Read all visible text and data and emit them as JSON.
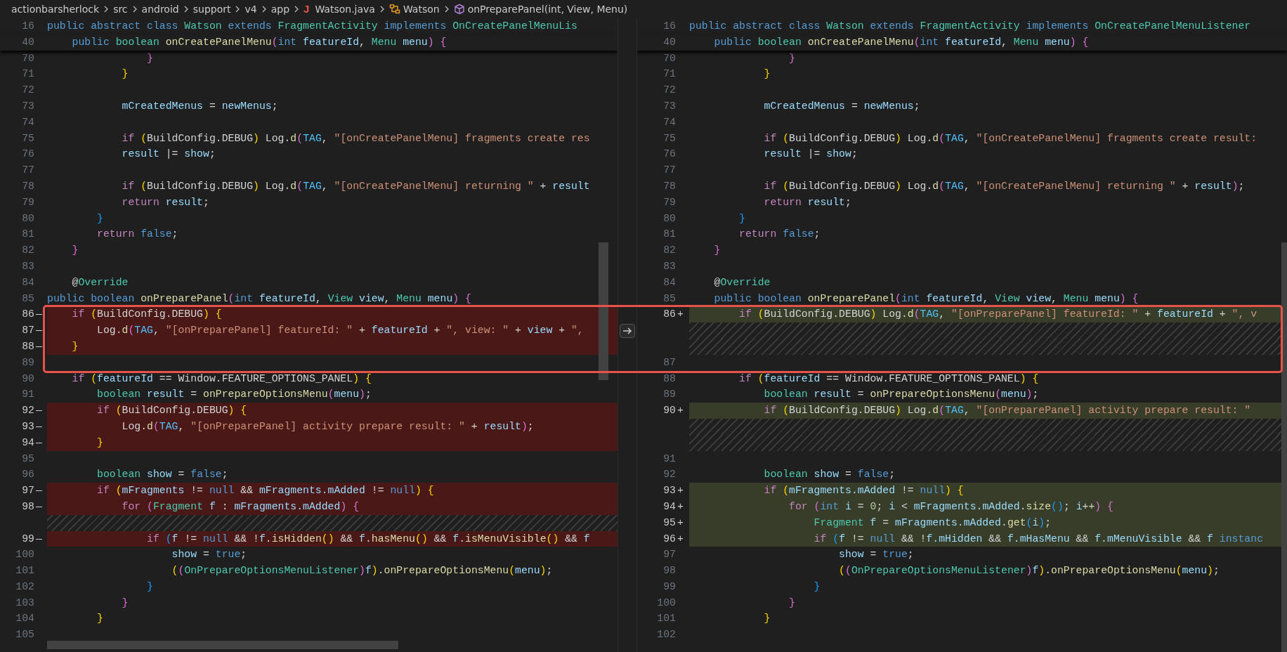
{
  "breadcrumb": [
    {
      "kind": "folder",
      "label": "actionbarsherlock"
    },
    {
      "kind": "folder",
      "label": "src"
    },
    {
      "kind": "folder",
      "label": "android"
    },
    {
      "kind": "folder",
      "label": "support"
    },
    {
      "kind": "folder",
      "label": "v4"
    },
    {
      "kind": "folder",
      "label": "app"
    },
    {
      "kind": "file",
      "glyph": "J",
      "label": "Watson.java"
    },
    {
      "kind": "class",
      "label": "Watson"
    },
    {
      "kind": "method",
      "label": "onPreparePanel(int, View, Menu)"
    }
  ],
  "left_pane": {
    "sticky": [
      {
        "number": "16",
        "tokens": [
          {
            "text": "public",
            "kind": "k"
          },
          {
            "text": " abstract",
            "kind": "k"
          },
          {
            "text": " class",
            "kind": "k"
          },
          {
            "text": " Watson",
            "kind": "t"
          },
          {
            "text": " extends",
            "kind": "k"
          },
          {
            "text": " FragmentActivity",
            "kind": "t"
          },
          {
            "text": " implements",
            "kind": "k"
          },
          {
            "text": " OnCreatePanelMenuLis",
            "kind": "t"
          }
        ]
      },
      {
        "number": "40",
        "tokens": [
          {
            "text": "    public",
            "kind": "k"
          },
          {
            "text": " boolean",
            "kind": "t"
          },
          {
            "text": " onCreatePanelMenu",
            "kind": "f"
          },
          {
            "text": "(",
            "kind": "b2"
          },
          {
            "text": "int",
            "kind": "k"
          },
          {
            "text": " featureId",
            "kind": "v"
          },
          {
            "text": ",",
            "kind": "p"
          },
          {
            "text": " Menu",
            "kind": "t"
          },
          {
            "text": " menu",
            "kind": "v"
          },
          {
            "text": ")",
            "kind": "b2"
          },
          {
            "text": " {",
            "kind": "b2"
          }
        ]
      }
    ],
    "rows": [
      {
        "kind": "context",
        "number": "70",
        "tokens": [
          {
            "text": "                }",
            "kind": "b2"
          }
        ]
      },
      {
        "kind": "context",
        "number": "71",
        "tokens": [
          {
            "text": "            }",
            "kind": "b1"
          }
        ]
      },
      {
        "kind": "context",
        "number": "72"
      },
      {
        "kind": "context",
        "number": "73",
        "tokens": [
          {
            "text": "            mCreatedMenus",
            "kind": "v"
          },
          {
            "text": " =",
            "kind": "p"
          },
          {
            "text": " newMenus",
            "kind": "v"
          },
          {
            "text": ";",
            "kind": "p"
          }
        ]
      },
      {
        "kind": "context",
        "number": "74"
      },
      {
        "kind": "context",
        "number": "75",
        "tokens": [
          {
            "text": "            if",
            "kind": "c"
          },
          {
            "text": " (",
            "kind": "b1"
          },
          {
            "text": "BuildConfig.DEBUG",
            "kind": "p"
          },
          {
            "text": ")",
            "kind": "b1"
          },
          {
            "text": " Log.",
            "kind": "p"
          },
          {
            "text": "d",
            "kind": "f"
          },
          {
            "text": "(",
            "kind": "b2"
          },
          {
            "text": "TAG",
            "kind": "n"
          },
          {
            "text": ",",
            "kind": "p"
          },
          {
            "text": " \"[onCreatePanelMenu] fragments create res",
            "kind": "s"
          }
        ]
      },
      {
        "kind": "context",
        "number": "76",
        "tokens": [
          {
            "text": "            result",
            "kind": "v"
          },
          {
            "text": " |=",
            "kind": "p"
          },
          {
            "text": " show",
            "kind": "v"
          },
          {
            "text": ";",
            "kind": "p"
          }
        ]
      },
      {
        "kind": "context",
        "number": "77"
      },
      {
        "kind": "context",
        "number": "78",
        "tokens": [
          {
            "text": "            if",
            "kind": "c"
          },
          {
            "text": " (",
            "kind": "b1"
          },
          {
            "text": "BuildConfig.DEBUG",
            "kind": "p"
          },
          {
            "text": ")",
            "kind": "b1"
          },
          {
            "text": " Log.",
            "kind": "p"
          },
          {
            "text": "d",
            "kind": "f"
          },
          {
            "text": "(",
            "kind": "b2"
          },
          {
            "text": "TAG",
            "kind": "n"
          },
          {
            "text": ",",
            "kind": "p"
          },
          {
            "text": " \"[onCreatePanelMenu] returning \"",
            "kind": "s"
          },
          {
            "text": " +",
            "kind": "p"
          },
          {
            "text": " result",
            "kind": "v"
          }
        ]
      },
      {
        "kind": "context",
        "number": "79",
        "tokens": [
          {
            "text": "            return",
            "kind": "c"
          },
          {
            "text": " result",
            "kind": "v"
          },
          {
            "text": ";",
            "kind": "p"
          }
        ]
      },
      {
        "kind": "context",
        "number": "80",
        "tokens": [
          {
            "text": "        }",
            "kind": "b3"
          }
        ]
      },
      {
        "kind": "context",
        "number": "81",
        "tokens": [
          {
            "text": "        return",
            "kind": "c"
          },
          {
            "text": " false",
            "kind": "k"
          },
          {
            "text": ";",
            "kind": "p"
          }
        ]
      },
      {
        "kind": "context",
        "number": "82",
        "tokens": [
          {
            "text": "    }",
            "kind": "b2"
          }
        ]
      },
      {
        "kind": "context",
        "number": "83"
      },
      {
        "kind": "context",
        "number": "84",
        "tokens": [
          {
            "text": "    @",
            "kind": "p"
          },
          {
            "text": "Override",
            "kind": "t"
          }
        ]
      },
      {
        "kind": "context",
        "number": "85",
        "tokens": [
          {
            "text": "public",
            "kind": "k"
          },
          {
            "text": " boolean",
            "kind": "k"
          },
          {
            "text": " onPreparePanel",
            "kind": "f"
          },
          {
            "text": "(",
            "kind": "b2"
          },
          {
            "text": "int",
            "kind": "k"
          },
          {
            "text": " featureId",
            "kind": "v"
          },
          {
            "text": ",",
            "kind": "p"
          },
          {
            "text": " View",
            "kind": "t"
          },
          {
            "text": " view",
            "kind": "v"
          },
          {
            "text": ",",
            "kind": "p"
          },
          {
            "text": " Menu",
            "kind": "t"
          },
          {
            "text": " menu",
            "kind": "v"
          },
          {
            "text": ")",
            "kind": "b2"
          },
          {
            "text": " {",
            "kind": "b2"
          }
        ]
      },
      {
        "kind": "removed",
        "number": "86",
        "sign": "—",
        "framed": true,
        "tokens": [
          {
            "text": "    if",
            "kind": "c"
          },
          {
            "text": " (",
            "kind": "b1"
          },
          {
            "text": "BuildConfig.DEBUG",
            "kind": "p"
          },
          {
            "text": ")",
            "kind": "b1"
          },
          {
            "text": " {",
            "kind": "b1"
          }
        ]
      },
      {
        "kind": "removed",
        "number": "87",
        "sign": "—",
        "framed": true,
        "revert_button": true,
        "tokens": [
          {
            "text": "        Log.",
            "kind": "p"
          },
          {
            "text": "d",
            "kind": "f"
          },
          {
            "text": "(",
            "kind": "b2"
          },
          {
            "text": "TAG",
            "kind": "n"
          },
          {
            "text": ",",
            "kind": "p"
          },
          {
            "text": " \"[onPreparePanel] featureId: \"",
            "kind": "s"
          },
          {
            "text": " +",
            "kind": "p"
          },
          {
            "text": " featureId",
            "kind": "v"
          },
          {
            "text": " +",
            "kind": "p"
          },
          {
            "text": " \", view: \"",
            "kind": "s"
          },
          {
            "text": " +",
            "kind": "p"
          },
          {
            "text": " view",
            "kind": "v"
          },
          {
            "text": " +",
            "kind": "p"
          },
          {
            "text": " \",",
            "kind": "s"
          }
        ]
      },
      {
        "kind": "removed",
        "number": "88",
        "sign": "—",
        "framed": true,
        "tokens": [
          {
            "text": "    }",
            "kind": "b1"
          }
        ]
      },
      {
        "kind": "context",
        "number": "89",
        "framed": true
      },
      {
        "kind": "context",
        "number": "90",
        "tokens": [
          {
            "text": "    if",
            "kind": "c"
          },
          {
            "text": " (",
            "kind": "b1"
          },
          {
            "text": "featureId",
            "kind": "v"
          },
          {
            "text": " == Window.FEATURE_OPTIONS_PANEL",
            "kind": "p"
          },
          {
            "text": ")",
            "kind": "b1"
          },
          {
            "text": " {",
            "kind": "b1"
          }
        ]
      },
      {
        "kind": "context",
        "number": "91",
        "tokens": [
          {
            "text": "        boolean",
            "kind": "t"
          },
          {
            "text": " result",
            "kind": "v"
          },
          {
            "text": " =",
            "kind": "p"
          },
          {
            "text": " onPrepareOptionsMenu",
            "kind": "f"
          },
          {
            "text": "(",
            "kind": "b2"
          },
          {
            "text": "menu",
            "kind": "v"
          },
          {
            "text": ")",
            "kind": "b2"
          },
          {
            "text": ";",
            "kind": "p"
          }
        ]
      },
      {
        "kind": "removed",
        "number": "92",
        "sign": "—",
        "tokens": [
          {
            "text": "        if",
            "kind": "c"
          },
          {
            "text": " (",
            "kind": "b1"
          },
          {
            "text": "BuildConfig.DEBUG",
            "kind": "p"
          },
          {
            "text": ")",
            "kind": "b1"
          },
          {
            "text": " {",
            "kind": "b1"
          }
        ]
      },
      {
        "kind": "removed",
        "number": "93",
        "sign": "—",
        "tokens": [
          {
            "text": "            Log.",
            "kind": "p"
          },
          {
            "text": "d",
            "kind": "f"
          },
          {
            "text": "(",
            "kind": "b2"
          },
          {
            "text": "TAG",
            "kind": "n"
          },
          {
            "text": ",",
            "kind": "p"
          },
          {
            "text": " \"[onPreparePanel] activity prepare result: \"",
            "kind": "s"
          },
          {
            "text": " +",
            "kind": "p"
          },
          {
            "text": " result",
            "kind": "v"
          },
          {
            "text": ")",
            "kind": "b2"
          },
          {
            "text": ";",
            "kind": "p"
          }
        ]
      },
      {
        "kind": "removed",
        "number": "94",
        "sign": "—",
        "tokens": [
          {
            "text": "        }",
            "kind": "b1"
          }
        ]
      },
      {
        "kind": "context",
        "number": "95"
      },
      {
        "kind": "context",
        "number": "96",
        "tokens": [
          {
            "text": "        boolean",
            "kind": "t"
          },
          {
            "text": " show",
            "kind": "v"
          },
          {
            "text": " =",
            "kind": "p"
          },
          {
            "text": " false",
            "kind": "k"
          },
          {
            "text": ";",
            "kind": "p"
          }
        ]
      },
      {
        "kind": "removed",
        "number": "97",
        "sign": "—",
        "tokens": [
          {
            "text": "        if",
            "kind": "c"
          },
          {
            "text": " (",
            "kind": "b1"
          },
          {
            "text": "mFragments",
            "kind": "v"
          },
          {
            "text": " !=",
            "kind": "p"
          },
          {
            "text": " null",
            "kind": "k"
          },
          {
            "text": " &&",
            "kind": "p"
          },
          {
            "text": " mFragments.mAdded",
            "kind": "v"
          },
          {
            "text": " !=",
            "kind": "p"
          },
          {
            "text": " null",
            "kind": "k"
          },
          {
            "text": ")",
            "kind": "b1"
          },
          {
            "text": " {",
            "kind": "b1"
          }
        ]
      },
      {
        "kind": "removed",
        "number": "98",
        "sign": "—",
        "tokens": [
          {
            "text": "            for",
            "kind": "c"
          },
          {
            "text": " (",
            "kind": "b2"
          },
          {
            "text": "Fragment",
            "kind": "t"
          },
          {
            "text": " f",
            "kind": "v"
          },
          {
            "text": " :",
            "kind": "p"
          },
          {
            "text": " mFragments.mAdded",
            "kind": "v"
          },
          {
            "text": ")",
            "kind": "b2"
          },
          {
            "text": " {",
            "kind": "b2"
          }
        ]
      },
      {
        "kind": "filler"
      },
      {
        "kind": "removed",
        "number": "99",
        "sign": "—",
        "tokens": [
          {
            "text": "                if",
            "kind": "c"
          },
          {
            "text": " (",
            "kind": "b3"
          },
          {
            "text": "f",
            "kind": "v"
          },
          {
            "text": " !=",
            "kind": "p"
          },
          {
            "text": " null",
            "kind": "k"
          },
          {
            "text": " && !",
            "kind": "p"
          },
          {
            "text": "f",
            "kind": "v"
          },
          {
            "text": ".",
            "kind": "p"
          },
          {
            "text": "isHidden",
            "kind": "f"
          },
          {
            "text": "()",
            "kind": "b1"
          },
          {
            "text": " &&",
            "kind": "p"
          },
          {
            "text": " f",
            "kind": "v"
          },
          {
            "text": ".",
            "kind": "p"
          },
          {
            "text": "hasMenu",
            "kind": "f"
          },
          {
            "text": "()",
            "kind": "b1"
          },
          {
            "text": " &&",
            "kind": "p"
          },
          {
            "text": " f",
            "kind": "v"
          },
          {
            "text": ".",
            "kind": "p"
          },
          {
            "text": "isMenuVisible",
            "kind": "f"
          },
          {
            "text": "()",
            "kind": "b1"
          },
          {
            "text": " &&",
            "kind": "p"
          },
          {
            "text": " f",
            "kind": "v"
          }
        ]
      },
      {
        "kind": "context",
        "number": "100",
        "tokens": [
          {
            "text": "                    show",
            "kind": "v"
          },
          {
            "text": " =",
            "kind": "p"
          },
          {
            "text": " true",
            "kind": "k"
          },
          {
            "text": ";",
            "kind": "p"
          }
        ]
      },
      {
        "kind": "context",
        "number": "101",
        "tokens": [
          {
            "text": "                    (",
            "kind": "b1"
          },
          {
            "text": "(",
            "kind": "b2"
          },
          {
            "text": "OnPrepareOptionsMenuListener",
            "kind": "t"
          },
          {
            "text": ")",
            "kind": "b2"
          },
          {
            "text": "f",
            "kind": "v"
          },
          {
            "text": ")",
            "kind": "b1"
          },
          {
            "text": ".",
            "kind": "p"
          },
          {
            "text": "onPrepareOptionsMenu",
            "kind": "f"
          },
          {
            "text": "(",
            "kind": "b1"
          },
          {
            "text": "menu",
            "kind": "v"
          },
          {
            "text": ")",
            "kind": "b1"
          },
          {
            "text": ";",
            "kind": "p"
          }
        ]
      },
      {
        "kind": "context",
        "number": "102",
        "tokens": [
          {
            "text": "                }",
            "kind": "b3"
          }
        ]
      },
      {
        "kind": "context",
        "number": "103",
        "tokens": [
          {
            "text": "            }",
            "kind": "b2"
          }
        ]
      },
      {
        "kind": "context",
        "number": "104",
        "tokens": [
          {
            "text": "        }",
            "kind": "b1"
          }
        ]
      },
      {
        "kind": "context",
        "number": "105"
      }
    ]
  },
  "right_pane": {
    "sticky": [
      {
        "number": "16",
        "tokens": [
          {
            "text": "public",
            "kind": "k"
          },
          {
            "text": " abstract",
            "kind": "k"
          },
          {
            "text": " class",
            "kind": "k"
          },
          {
            "text": " Watson",
            "kind": "t"
          },
          {
            "text": " extends",
            "kind": "k"
          },
          {
            "text": " FragmentActivity",
            "kind": "t"
          },
          {
            "text": " implements",
            "kind": "k"
          },
          {
            "text": " OnCreatePanelMenuListener",
            "kind": "t"
          }
        ]
      },
      {
        "number": "40",
        "tokens": [
          {
            "text": "    public",
            "kind": "k"
          },
          {
            "text": " boolean",
            "kind": "t"
          },
          {
            "text": " onCreatePanelMenu",
            "kind": "f"
          },
          {
            "text": "(",
            "kind": "b2"
          },
          {
            "text": "int",
            "kind": "k"
          },
          {
            "text": " featureId",
            "kind": "v"
          },
          {
            "text": ",",
            "kind": "p"
          },
          {
            "text": " Menu",
            "kind": "t"
          },
          {
            "text": " menu",
            "kind": "v"
          },
          {
            "text": ")",
            "kind": "b2"
          },
          {
            "text": " {",
            "kind": "b2"
          }
        ]
      }
    ],
    "rows": [
      {
        "kind": "context",
        "number": "70",
        "tokens": [
          {
            "text": "                }",
            "kind": "b2"
          }
        ]
      },
      {
        "kind": "context",
        "number": "71",
        "tokens": [
          {
            "text": "            }",
            "kind": "b1"
          }
        ]
      },
      {
        "kind": "context",
        "number": "72"
      },
      {
        "kind": "context",
        "number": "73",
        "tokens": [
          {
            "text": "            mCreatedMenus",
            "kind": "v"
          },
          {
            "text": " =",
            "kind": "p"
          },
          {
            "text": " newMenus",
            "kind": "v"
          },
          {
            "text": ";",
            "kind": "p"
          }
        ]
      },
      {
        "kind": "context",
        "number": "74"
      },
      {
        "kind": "context",
        "number": "75",
        "tokens": [
          {
            "text": "            if",
            "kind": "c"
          },
          {
            "text": " (",
            "kind": "b1"
          },
          {
            "text": "BuildConfig.DEBUG",
            "kind": "p"
          },
          {
            "text": ")",
            "kind": "b1"
          },
          {
            "text": " Log.",
            "kind": "p"
          },
          {
            "text": "d",
            "kind": "f"
          },
          {
            "text": "(",
            "kind": "b2"
          },
          {
            "text": "TAG",
            "kind": "n"
          },
          {
            "text": ",",
            "kind": "p"
          },
          {
            "text": " \"[onCreatePanelMenu] fragments create result:",
            "kind": "s"
          }
        ]
      },
      {
        "kind": "context",
        "number": "76",
        "tokens": [
          {
            "text": "            result",
            "kind": "v"
          },
          {
            "text": " |=",
            "kind": "p"
          },
          {
            "text": " show",
            "kind": "v"
          },
          {
            "text": ";",
            "kind": "p"
          }
        ]
      },
      {
        "kind": "context",
        "number": "77"
      },
      {
        "kind": "context",
        "number": "78",
        "tokens": [
          {
            "text": "            if",
            "kind": "c"
          },
          {
            "text": " (",
            "kind": "b1"
          },
          {
            "text": "BuildConfig.DEBUG",
            "kind": "p"
          },
          {
            "text": ")",
            "kind": "b1"
          },
          {
            "text": " Log.",
            "kind": "p"
          },
          {
            "text": "d",
            "kind": "f"
          },
          {
            "text": "(",
            "kind": "b2"
          },
          {
            "text": "TAG",
            "kind": "n"
          },
          {
            "text": ",",
            "kind": "p"
          },
          {
            "text": " \"[onCreatePanelMenu] returning \"",
            "kind": "s"
          },
          {
            "text": " +",
            "kind": "p"
          },
          {
            "text": " result",
            "kind": "v"
          },
          {
            "text": ")",
            "kind": "b2"
          },
          {
            "text": ";",
            "kind": "p"
          }
        ]
      },
      {
        "kind": "context",
        "number": "79",
        "tokens": [
          {
            "text": "            return",
            "kind": "c"
          },
          {
            "text": " result",
            "kind": "v"
          },
          {
            "text": ";",
            "kind": "p"
          }
        ]
      },
      {
        "kind": "context",
        "number": "80",
        "tokens": [
          {
            "text": "        }",
            "kind": "b3"
          }
        ]
      },
      {
        "kind": "context",
        "number": "81",
        "tokens": [
          {
            "text": "        return",
            "kind": "c"
          },
          {
            "text": " false",
            "kind": "k"
          },
          {
            "text": ";",
            "kind": "p"
          }
        ]
      },
      {
        "kind": "context",
        "number": "82",
        "tokens": [
          {
            "text": "    }",
            "kind": "b2"
          }
        ]
      },
      {
        "kind": "context",
        "number": "83"
      },
      {
        "kind": "context",
        "number": "84",
        "tokens": [
          {
            "text": "    @",
            "kind": "p"
          },
          {
            "text": "Override",
            "kind": "t"
          }
        ]
      },
      {
        "kind": "context",
        "number": "85",
        "tokens": [
          {
            "text": "    public",
            "kind": "k"
          },
          {
            "text": " boolean",
            "kind": "k"
          },
          {
            "text": " onPreparePanel",
            "kind": "f"
          },
          {
            "text": "(",
            "kind": "b2"
          },
          {
            "text": "int",
            "kind": "k"
          },
          {
            "text": " featureId",
            "kind": "v"
          },
          {
            "text": ",",
            "kind": "p"
          },
          {
            "text": " View",
            "kind": "t"
          },
          {
            "text": " view",
            "kind": "v"
          },
          {
            "text": ",",
            "kind": "p"
          },
          {
            "text": " Menu",
            "kind": "t"
          },
          {
            "text": " menu",
            "kind": "v"
          },
          {
            "text": ")",
            "kind": "b2"
          },
          {
            "text": " {",
            "kind": "b2"
          }
        ]
      },
      {
        "kind": "added",
        "number": "86",
        "sign": "+",
        "tokens": [
          {
            "text": "        if",
            "kind": "c"
          },
          {
            "text": " (",
            "kind": "b1"
          },
          {
            "text": "BuildConfig.DEBUG",
            "kind": "p"
          },
          {
            "text": ")",
            "kind": "b1"
          },
          {
            "text": " Log.",
            "kind": "p"
          },
          {
            "text": "d",
            "kind": "f"
          },
          {
            "text": "(",
            "kind": "b2"
          },
          {
            "text": "TAG",
            "kind": "n"
          },
          {
            "text": ",",
            "kind": "p"
          },
          {
            "text": " \"[onPreparePanel] featureId: \"",
            "kind": "s"
          },
          {
            "text": " +",
            "kind": "p"
          },
          {
            "text": " featureId",
            "kind": "v"
          },
          {
            "text": " +",
            "kind": "p"
          },
          {
            "text": " \", v",
            "kind": "s"
          }
        ]
      },
      {
        "kind": "filler"
      },
      {
        "kind": "filler"
      },
      {
        "kind": "context",
        "number": "87"
      },
      {
        "kind": "context",
        "number": "88",
        "tokens": [
          {
            "text": "        if",
            "kind": "c"
          },
          {
            "text": " (",
            "kind": "b1"
          },
          {
            "text": "featureId",
            "kind": "v"
          },
          {
            "text": " == Window.FEATURE_OPTIONS_PANEL",
            "kind": "p"
          },
          {
            "text": ")",
            "kind": "b1"
          },
          {
            "text": " {",
            "kind": "b1"
          }
        ]
      },
      {
        "kind": "context",
        "number": "89",
        "tokens": [
          {
            "text": "            boolean",
            "kind": "t"
          },
          {
            "text": " result",
            "kind": "v"
          },
          {
            "text": " =",
            "kind": "p"
          },
          {
            "text": " onPrepareOptionsMenu",
            "kind": "f"
          },
          {
            "text": "(",
            "kind": "b2"
          },
          {
            "text": "menu",
            "kind": "v"
          },
          {
            "text": ")",
            "kind": "b2"
          },
          {
            "text": ";",
            "kind": "p"
          }
        ]
      },
      {
        "kind": "added",
        "number": "90",
        "sign": "+",
        "tokens": [
          {
            "text": "            if",
            "kind": "c"
          },
          {
            "text": " (",
            "kind": "b1"
          },
          {
            "text": "BuildConfig.DEBUG",
            "kind": "p"
          },
          {
            "text": ")",
            "kind": "b1"
          },
          {
            "text": " Log.",
            "kind": "p"
          },
          {
            "text": "d",
            "kind": "f"
          },
          {
            "text": "(",
            "kind": "b2"
          },
          {
            "text": "TAG",
            "kind": "n"
          },
          {
            "text": ",",
            "kind": "p"
          },
          {
            "text": " \"[onPreparePanel] activity prepare result: \"",
            "kind": "s"
          }
        ]
      },
      {
        "kind": "filler"
      },
      {
        "kind": "filler"
      },
      {
        "kind": "context",
        "number": "91"
      },
      {
        "kind": "context",
        "number": "92",
        "tokens": [
          {
            "text": "            boolean",
            "kind": "t"
          },
          {
            "text": " show",
            "kind": "v"
          },
          {
            "text": " =",
            "kind": "p"
          },
          {
            "text": " false",
            "kind": "k"
          },
          {
            "text": ";",
            "kind": "p"
          }
        ]
      },
      {
        "kind": "added",
        "number": "93",
        "sign": "+",
        "tokens": [
          {
            "text": "            if",
            "kind": "c"
          },
          {
            "text": " (",
            "kind": "b1"
          },
          {
            "text": "mFragments.mAdded",
            "kind": "v"
          },
          {
            "text": " !=",
            "kind": "p"
          },
          {
            "text": " null",
            "kind": "k"
          },
          {
            "text": ")",
            "kind": "b1"
          },
          {
            "text": " {",
            "kind": "b1"
          }
        ]
      },
      {
        "kind": "added",
        "number": "94",
        "sign": "+",
        "tokens": [
          {
            "text": "                for",
            "kind": "c"
          },
          {
            "text": " (",
            "kind": "b2"
          },
          {
            "text": "int",
            "kind": "k"
          },
          {
            "text": " i",
            "kind": "v"
          },
          {
            "text": " =",
            "kind": "p"
          },
          {
            "text": " 0",
            "kind": "m"
          },
          {
            "text": ";",
            "kind": "p"
          },
          {
            "text": " i",
            "kind": "v"
          },
          {
            "text": " <",
            "kind": "p"
          },
          {
            "text": " mFragments.mAdded",
            "kind": "v"
          },
          {
            "text": ".",
            "kind": "p"
          },
          {
            "text": "size",
            "kind": "f"
          },
          {
            "text": "()",
            "kind": "b3"
          },
          {
            "text": ";",
            "kind": "p"
          },
          {
            "text": " i",
            "kind": "v"
          },
          {
            "text": "++",
            "kind": "p"
          },
          {
            "text": ")",
            "kind": "b2"
          },
          {
            "text": " {",
            "kind": "b2"
          }
        ]
      },
      {
        "kind": "added",
        "number": "95",
        "sign": "+",
        "tokens": [
          {
            "text": "                    Fragment",
            "kind": "t"
          },
          {
            "text": " f",
            "kind": "v"
          },
          {
            "text": " =",
            "kind": "p"
          },
          {
            "text": " mFragments.mAdded",
            "kind": "v"
          },
          {
            "text": ".",
            "kind": "p"
          },
          {
            "text": "get",
            "kind": "f"
          },
          {
            "text": "(",
            "kind": "b3"
          },
          {
            "text": "i",
            "kind": "v"
          },
          {
            "text": ")",
            "kind": "b3"
          },
          {
            "text": ";",
            "kind": "p"
          }
        ]
      },
      {
        "kind": "added",
        "number": "96",
        "sign": "+",
        "tokens": [
          {
            "text": "                    if",
            "kind": "c"
          },
          {
            "text": " (",
            "kind": "b3"
          },
          {
            "text": "f",
            "kind": "v"
          },
          {
            "text": " !=",
            "kind": "p"
          },
          {
            "text": " null",
            "kind": "k"
          },
          {
            "text": " && !",
            "kind": "p"
          },
          {
            "text": "f.mHidden",
            "kind": "v"
          },
          {
            "text": " &&",
            "kind": "p"
          },
          {
            "text": " f.mHasMenu",
            "kind": "v"
          },
          {
            "text": " &&",
            "kind": "p"
          },
          {
            "text": " f.mMenuVisible",
            "kind": "v"
          },
          {
            "text": " &&",
            "kind": "p"
          },
          {
            "text": " f",
            "kind": "v"
          },
          {
            "text": " instanc",
            "kind": "k"
          }
        ]
      },
      {
        "kind": "context",
        "number": "97",
        "tokens": [
          {
            "text": "                        show",
            "kind": "v"
          },
          {
            "text": " =",
            "kind": "p"
          },
          {
            "text": " true",
            "kind": "k"
          },
          {
            "text": ";",
            "kind": "p"
          }
        ]
      },
      {
        "kind": "context",
        "number": "98",
        "tokens": [
          {
            "text": "                        (",
            "kind": "b1"
          },
          {
            "text": "(",
            "kind": "b2"
          },
          {
            "text": "OnPrepareOptionsMenuListener",
            "kind": "t"
          },
          {
            "text": ")",
            "kind": "b2"
          },
          {
            "text": "f",
            "kind": "v"
          },
          {
            "text": ")",
            "kind": "b1"
          },
          {
            "text": ".",
            "kind": "p"
          },
          {
            "text": "onPrepareOptionsMenu",
            "kind": "f"
          },
          {
            "text": "(",
            "kind": "b1"
          },
          {
            "text": "menu",
            "kind": "v"
          },
          {
            "text": ")",
            "kind": "b1"
          },
          {
            "text": ";",
            "kind": "p"
          }
        ]
      },
      {
        "kind": "context",
        "number": "99",
        "tokens": [
          {
            "text": "                    }",
            "kind": "b3"
          }
        ]
      },
      {
        "kind": "context",
        "number": "100",
        "tokens": [
          {
            "text": "                }",
            "kind": "b2"
          }
        ]
      },
      {
        "kind": "context",
        "number": "101",
        "tokens": [
          {
            "text": "            }",
            "kind": "b1"
          }
        ]
      },
      {
        "kind": "context",
        "number": "102"
      }
    ]
  }
}
